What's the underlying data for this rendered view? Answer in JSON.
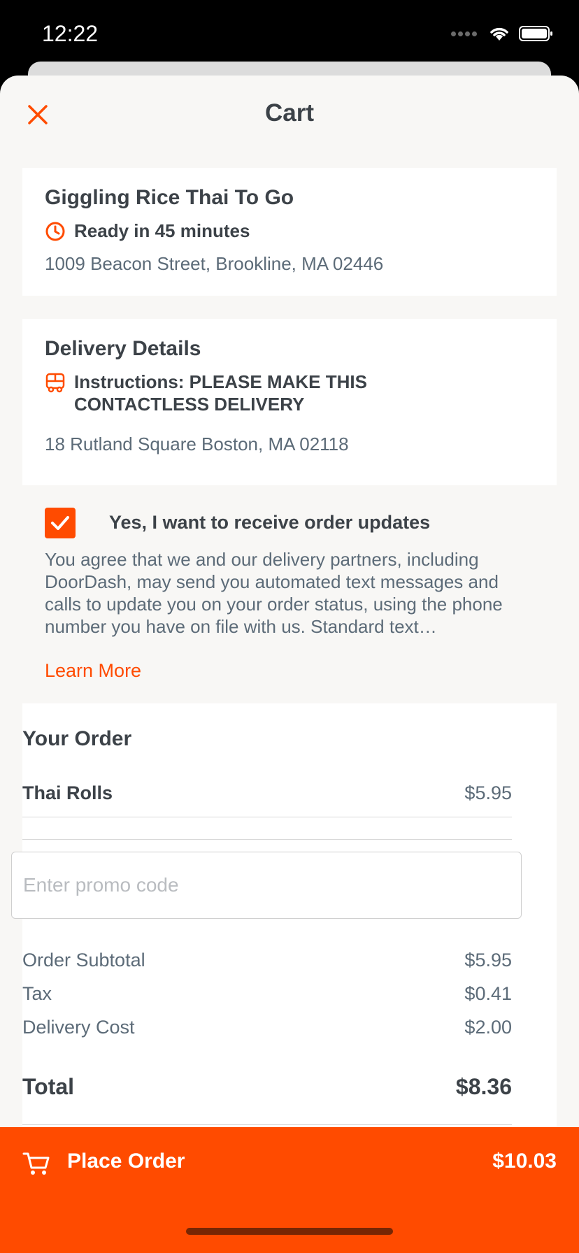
{
  "status_bar": {
    "time": "12:22"
  },
  "header": {
    "title": "Cart",
    "close_icon": "close-icon"
  },
  "store": {
    "name": "Giggling Rice Thai To Go",
    "ready_text": "Ready in 45 minutes",
    "address": "1009 Beacon Street, Brookline, MA 02446"
  },
  "delivery": {
    "heading": "Delivery Details",
    "instructions_line1": "Instructions: PLEASE MAKE THIS",
    "instructions_line2": "CONTACTLESS DELIVERY",
    "address": "18 Rutland Square  Boston, MA 02118"
  },
  "opt_in": {
    "checked": true,
    "label": "Yes, I want to receive order updates",
    "body": "You agree that we and our delivery partners, including DoorDash, may send you automated text messages and calls to update you on your order status, using the phone number you have on file with us. Standard text…",
    "learn_more": "Learn More"
  },
  "order": {
    "heading": "Your Order",
    "items": [
      {
        "name": "Thai Rolls",
        "price": "$5.95"
      }
    ],
    "promo_placeholder": "Enter promo code",
    "subtotal_label": "Order Subtotal",
    "subtotal": "$5.95",
    "tax_label": "Tax",
    "tax": "$0.41",
    "delivery_label": "Delivery Cost",
    "delivery_cost": "$2.00",
    "total_label": "Total",
    "total": "$8.36"
  },
  "place_order": {
    "label": "Place Order",
    "amount": "$10.03"
  },
  "colors": {
    "accent": "#ff4b00",
    "text": "#3c4248",
    "muted": "#5c6b78",
    "background": "#f8f7f5"
  }
}
